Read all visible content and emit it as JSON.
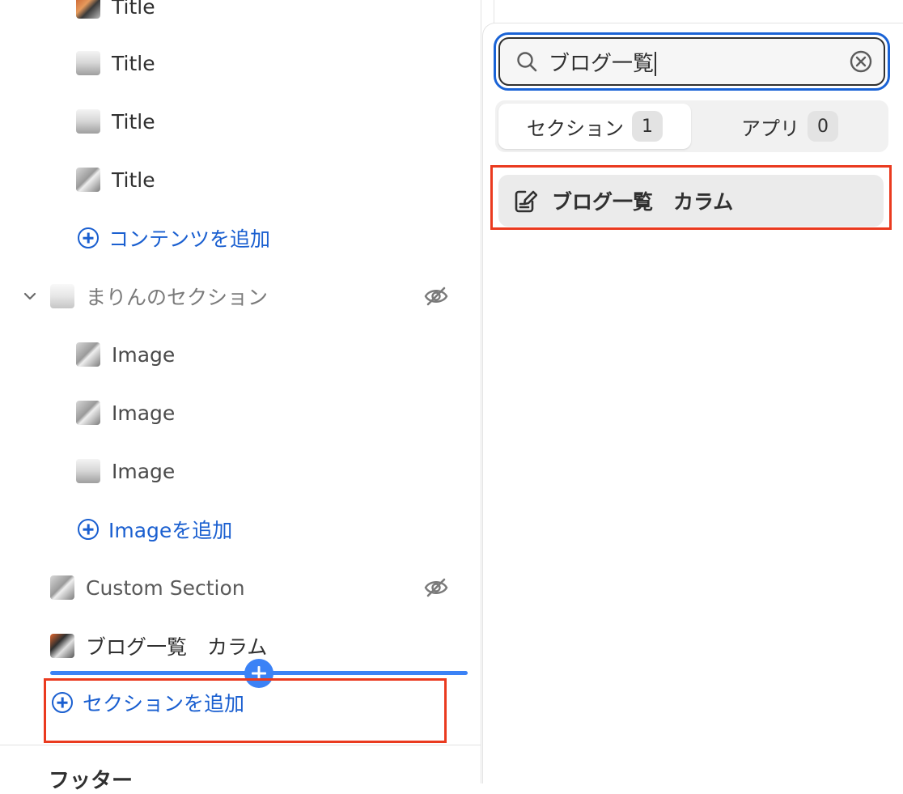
{
  "sidebar": {
    "content_items": [
      {
        "label": "Title",
        "thumb": "product-thumbnail"
      },
      {
        "label": "Title",
        "thumb": "product-thumbnail"
      },
      {
        "label": "Title",
        "thumb": "product-thumbnail"
      },
      {
        "label": "Title",
        "thumb": "product-thumbnail"
      }
    ],
    "add_content_label": "コンテンツを追加",
    "marin_section": {
      "label": "まりんのセクション",
      "hidden": true,
      "items": [
        {
          "label": "Image"
        },
        {
          "label": "Image"
        },
        {
          "label": "Image"
        }
      ],
      "add_image_label": "Imageを追加"
    },
    "custom_section": {
      "label": "Custom Section",
      "hidden": true
    },
    "blog_section": {
      "label": "ブログ一覧　カラム"
    },
    "add_section_label": "セクションを追加",
    "footer_title": "フッター"
  },
  "popover": {
    "search": {
      "value": "ブログ一覧",
      "placeholder": ""
    },
    "tabs": [
      {
        "label": "セクション",
        "count": "1",
        "active": true
      },
      {
        "label": "アプリ",
        "count": "0",
        "active": false
      }
    ],
    "results": [
      {
        "label": "ブログ一覧　カラム",
        "icon": "edit-note-icon"
      }
    ]
  },
  "colors": {
    "accent": "#1a5fd0",
    "highlight": "#ea3a1f",
    "drop_indicator": "#3b82f6"
  }
}
